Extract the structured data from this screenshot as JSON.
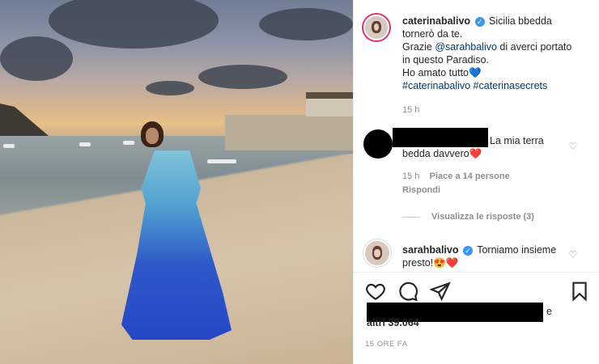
{
  "post": {
    "author": "caterinabalivo",
    "caption_line1": "Sicilia bbedda",
    "caption_line2": "tornerò da te.",
    "caption_line3_pre": "Grazie",
    "caption_mention": "@sarahbalivo",
    "caption_line3_post": "di averci portato",
    "caption_line4": "in questo Paradiso.",
    "caption_line5": "Ho amato tutto",
    "caption_line5_emoji": "💙",
    "hashtags": "#caterinabalivo #caterinasecrets",
    "time": "15 h"
  },
  "comments": [
    {
      "text_line1": "La mia terra",
      "text_line2": "bedda davvero",
      "emoji": "❤️",
      "time": "15 h",
      "likes": "Piace a 14 persone",
      "reply": "Rispondi",
      "view_replies": "Visualizza le risposte (3)"
    },
    {
      "author": "sarahbalivo",
      "text_line1": "Torniamo insieme",
      "text_line2": "presto!",
      "emoji": "😍❤️"
    }
  ],
  "footer": {
    "likes_tail": "e",
    "likes_count": "altri 39.064",
    "posted": "15 ORE FA"
  },
  "icons": [
    "heart-icon",
    "comment-icon",
    "share-icon",
    "bookmark-icon",
    "verified-icon"
  ],
  "colors": {
    "mention": "#00376b",
    "verified": "#3897f0",
    "meta": "#8e8e8e"
  }
}
